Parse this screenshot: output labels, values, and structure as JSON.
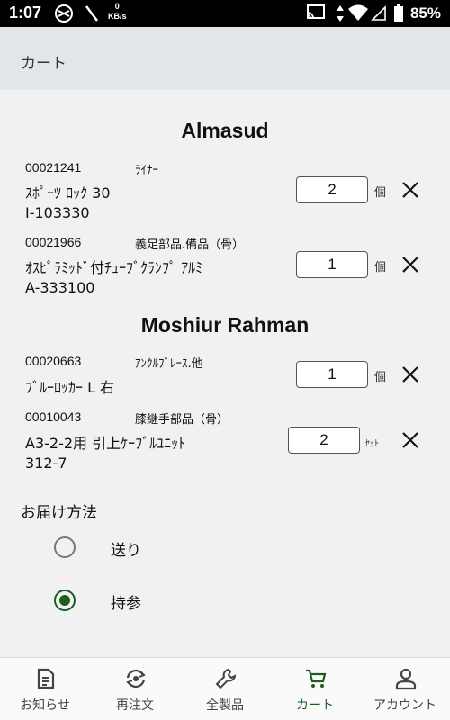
{
  "status_bar": {
    "time": "1:07",
    "speed_value": "0",
    "speed_unit": "KB/s",
    "battery": "85%"
  },
  "header": {
    "title": "カート"
  },
  "groups": [
    {
      "title": "Almasud",
      "items": [
        {
          "code": "00021241",
          "category": "ﾗｲﾅｰ",
          "name_line1": "ｽﾎﾟｰﾂ ﾛｯｸ 30",
          "name_line2": "I-103330",
          "qty": "2",
          "unit": "個"
        },
        {
          "code": "00021966",
          "category": "義足部品.備品（骨）",
          "name_line1": "ｵｽﾋﾟﾗﾐｯﾄﾞ付ﾁｭｰﾌﾞｸﾗﾝﾌﾟ ｱﾙﾐ",
          "name_line2": "A-333100",
          "qty": "1",
          "unit": "個"
        }
      ]
    },
    {
      "title": "Moshiur Rahman",
      "items": [
        {
          "code": "00020663",
          "category": "ｱﾝｸﾙﾌﾞﾚｰｽ.他",
          "name_line1": "ﾌﾞﾙｰﾛｯｶｰ L 右",
          "name_line2": "",
          "qty": "1",
          "unit": "個"
        },
        {
          "code": "00010043",
          "category": "膝継手部品（骨）",
          "name_line1": "A3-2-2用 引上ｹｰﾌﾞﾙﾕﾆｯﾄ",
          "name_line2": "312-7",
          "qty": "2",
          "unit": "ｾｯﾄ"
        }
      ]
    }
  ],
  "delivery": {
    "label": "お届け方法",
    "options": [
      {
        "label": "送り",
        "selected": false
      },
      {
        "label": "持参",
        "selected": true
      }
    ]
  },
  "bottom_nav": [
    {
      "label": "お知らせ",
      "icon": "document-icon",
      "active": false
    },
    {
      "label": "再注文",
      "icon": "reorder-icon",
      "active": false
    },
    {
      "label": "全製品",
      "icon": "wrench-icon",
      "active": false
    },
    {
      "label": "カート",
      "icon": "cart-icon",
      "active": true
    },
    {
      "label": "アカウント",
      "icon": "account-icon",
      "active": false
    }
  ],
  "colors": {
    "accent": "#1b5e20",
    "header_bg": "#e2e6e9",
    "page_bg": "#f1f1f1"
  }
}
